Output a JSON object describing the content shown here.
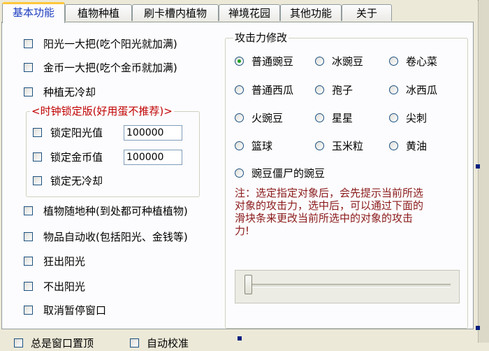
{
  "tabs": [
    {
      "label": "基本功能",
      "active": true
    },
    {
      "label": "植物种植",
      "active": false
    },
    {
      "label": "刷卡槽内植物",
      "active": false
    },
    {
      "label": "禅境花园",
      "active": false
    },
    {
      "label": "其他功能",
      "active": false
    },
    {
      "label": "关于",
      "active": false
    }
  ],
  "left_checkboxes_top": [
    {
      "label": "阳光一大把(吃个阳光就加满)",
      "checked": false
    },
    {
      "label": "金币一大把(吃个金币就加满)",
      "checked": false
    },
    {
      "label": "种植无冷却",
      "checked": false
    }
  ],
  "clock_group": {
    "title": "<时钟锁定版(好用蛋不推荐)>",
    "title_color": "#c00000",
    "items": [
      {
        "label": "锁定阳光值",
        "value": "100000",
        "checked": false
      },
      {
        "label": "锁定金币值",
        "value": "100000",
        "checked": false
      },
      {
        "label": "锁定无冷却",
        "checked": false
      }
    ]
  },
  "left_checkboxes_bottom": [
    {
      "label": "植物随地种(到处都可种植植物)",
      "checked": false
    },
    {
      "label": "物品自动收(包括阳光、金钱等)",
      "checked": false
    },
    {
      "label": "狂出阳光",
      "checked": false
    },
    {
      "label": "不出阳光",
      "checked": false
    },
    {
      "label": "取消暂停窗口",
      "checked": false
    }
  ],
  "attack_group": {
    "title": "攻击力修改",
    "options": [
      {
        "label": "普通豌豆",
        "checked": true
      },
      {
        "label": "冰豌豆",
        "checked": false
      },
      {
        "label": "卷心菜",
        "checked": false
      },
      {
        "label": "普通西瓜",
        "checked": false
      },
      {
        "label": "孢子",
        "checked": false
      },
      {
        "label": "冰西瓜",
        "checked": false
      },
      {
        "label": "火豌豆",
        "checked": false
      },
      {
        "label": "星星",
        "checked": false
      },
      {
        "label": "尖刺",
        "checked": false
      },
      {
        "label": "篮球",
        "checked": false
      },
      {
        "label": "玉米粒",
        "checked": false
      },
      {
        "label": "黄油",
        "checked": false
      },
      {
        "label": "豌豆僵尸的豌豆",
        "checked": false
      }
    ],
    "note": "注：选定指定对象后，会先提示当前所选对象的攻击力，选中后，可以通过下面的滑块条来更改当前所选中的对象的攻击力!",
    "note_color": "#8b1a1a",
    "slider_value": 0
  },
  "bottom": {
    "items": [
      {
        "label": "总是窗口置顶"
      },
      {
        "label": "自动校准"
      }
    ]
  }
}
